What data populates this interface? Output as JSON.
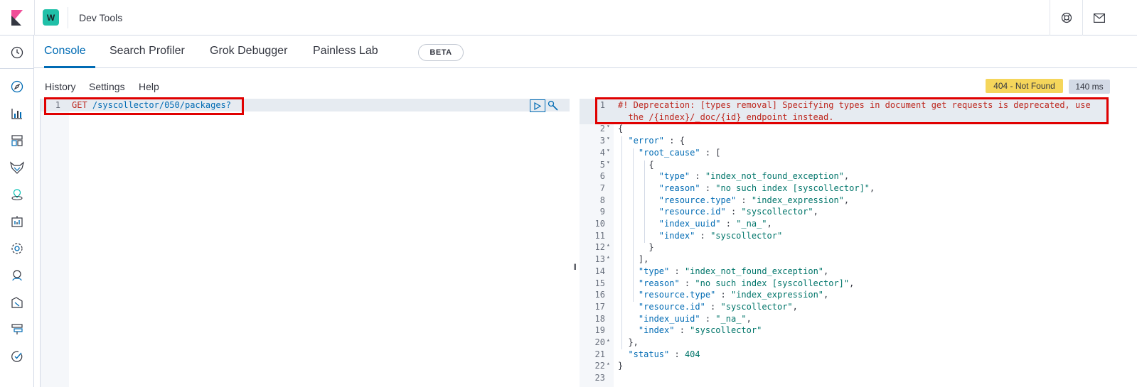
{
  "header": {
    "space_initial": "W",
    "app_title": "Dev Tools",
    "icons": {
      "logo": "kibana-logo",
      "help": "help-lifebuoy-icon",
      "mail": "newsfeed-mail-icon"
    }
  },
  "leftnav": {
    "items": [
      {
        "name": "recently-viewed-icon"
      },
      {
        "name": "discover-icon"
      },
      {
        "name": "visualize-icon"
      },
      {
        "name": "dashboard-icon"
      },
      {
        "name": "wazuh-icon"
      },
      {
        "name": "maps-icon"
      },
      {
        "name": "canvas-icon"
      },
      {
        "name": "ml-icon"
      },
      {
        "name": "metrics-icon"
      },
      {
        "name": "logs-icon"
      },
      {
        "name": "apm-icon"
      },
      {
        "name": "uptime-icon"
      }
    ]
  },
  "tabs": [
    {
      "label": "Console",
      "active": true
    },
    {
      "label": "Search Profiler",
      "active": false
    },
    {
      "label": "Grok Debugger",
      "active": false
    },
    {
      "label": "Painless Lab",
      "active": false,
      "badge": "BETA"
    }
  ],
  "console_menu": {
    "history": "History",
    "settings": "Settings",
    "help": "Help"
  },
  "response_status": {
    "status": "404 - Not Found",
    "status_color": "#f5d65b",
    "time": "140 ms"
  },
  "request": {
    "line_number": "1",
    "method": "GET",
    "path": "/syscollector/050/packages?"
  },
  "response": {
    "lines": [
      {
        "n": "1",
        "fold": "",
        "text": "#! Deprecation: [types removal] Specifying types in document get requests is deprecated, use"
      },
      {
        "n": "",
        "fold": "",
        "text": "  the /{index}/_doc/{id} endpoint instead."
      },
      {
        "n": "2",
        "fold": "▾",
        "text": "{"
      },
      {
        "n": "3",
        "fold": "▾",
        "text": "  \"error\" : {"
      },
      {
        "n": "4",
        "fold": "▾",
        "text": "    \"root_cause\" : ["
      },
      {
        "n": "5",
        "fold": "▾",
        "text": "      {"
      },
      {
        "n": "6",
        "fold": "",
        "text": "        \"type\" : \"index_not_found_exception\","
      },
      {
        "n": "7",
        "fold": "",
        "text": "        \"reason\" : \"no such index [syscollector]\","
      },
      {
        "n": "8",
        "fold": "",
        "text": "        \"resource.type\" : \"index_expression\","
      },
      {
        "n": "9",
        "fold": "",
        "text": "        \"resource.id\" : \"syscollector\","
      },
      {
        "n": "10",
        "fold": "",
        "text": "        \"index_uuid\" : \"_na_\","
      },
      {
        "n": "11",
        "fold": "",
        "text": "        \"index\" : \"syscollector\""
      },
      {
        "n": "12",
        "fold": "▴",
        "text": "      }"
      },
      {
        "n": "13",
        "fold": "▴",
        "text": "    ],"
      },
      {
        "n": "14",
        "fold": "",
        "text": "    \"type\" : \"index_not_found_exception\","
      },
      {
        "n": "15",
        "fold": "",
        "text": "    \"reason\" : \"no such index [syscollector]\","
      },
      {
        "n": "16",
        "fold": "",
        "text": "    \"resource.type\" : \"index_expression\","
      },
      {
        "n": "17",
        "fold": "",
        "text": "    \"resource.id\" : \"syscollector\","
      },
      {
        "n": "18",
        "fold": "",
        "text": "    \"index_uuid\" : \"_na_\","
      },
      {
        "n": "19",
        "fold": "",
        "text": "    \"index\" : \"syscollector\""
      },
      {
        "n": "20",
        "fold": "▴",
        "text": "  },"
      },
      {
        "n": "21",
        "fold": "",
        "text": "  \"status\" : 404"
      },
      {
        "n": "22",
        "fold": "▴",
        "text": "}"
      },
      {
        "n": "23",
        "fold": "",
        "text": ""
      }
    ]
  },
  "colors": {
    "accent": "#006bb4",
    "highlight_box": "#e00000"
  }
}
